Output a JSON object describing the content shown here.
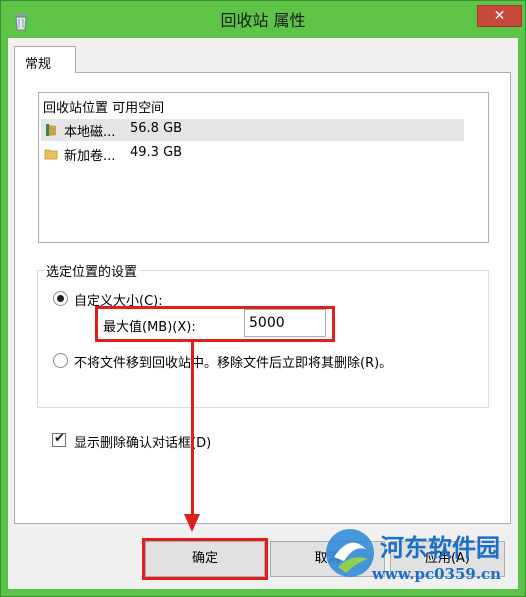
{
  "window": {
    "title": "回收站 属性",
    "close_label": "✕"
  },
  "tabs": [
    {
      "label": "常规",
      "active": true
    }
  ],
  "locations": {
    "header": "回收站位置  可用空间",
    "rows": [
      {
        "name": "本地磁...",
        "size": "56.8 GB",
        "selected": true,
        "icon": "drive-icon"
      },
      {
        "name": "新加卷...",
        "size": "49.3 GB",
        "selected": false,
        "icon": "folder-icon"
      }
    ]
  },
  "settings": {
    "group_title": "选定位置的设置",
    "custom_size": {
      "label": "自定义大小(C):",
      "selected": true
    },
    "max_size": {
      "label": "最大值(MB)(X):",
      "value": "5000"
    },
    "no_move": {
      "label": "不将文件移到回收站中。移除文件后立即将其删除(R)。",
      "selected": false
    }
  },
  "confirm_checkbox": {
    "label": "显示删除确认对话框(D)",
    "checked": true,
    "mark": "✔"
  },
  "buttons": {
    "ok": "确定",
    "cancel": "取消",
    "apply": "应用(A)"
  },
  "watermark": {
    "title": "河东软件园",
    "url": "www.pc0359.cn"
  },
  "colors": {
    "highlight": "#e01e1e",
    "titlebar": "#5ec447",
    "watermark": "#1b6fc6"
  }
}
